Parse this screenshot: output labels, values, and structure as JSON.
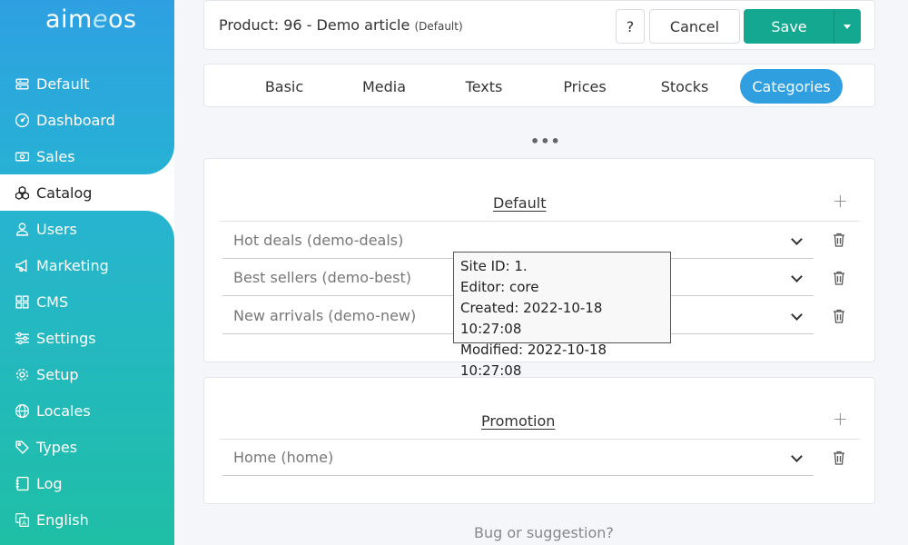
{
  "logo": {
    "text_before": "aim",
    "text_e": "e",
    "text_after": "os"
  },
  "sidebar": {
    "items": [
      {
        "label": "Default",
        "icon": "tray-icon"
      },
      {
        "label": "Dashboard",
        "icon": "dashboard-icon"
      },
      {
        "label": "Sales",
        "icon": "cash-icon"
      },
      {
        "label": "Catalog",
        "icon": "boxes-icon"
      },
      {
        "label": "Users",
        "icon": "user-icon"
      },
      {
        "label": "Marketing",
        "icon": "megaphone-icon"
      },
      {
        "label": "CMS",
        "icon": "grid-icon"
      },
      {
        "label": "Settings",
        "icon": "sliders-icon"
      },
      {
        "label": "Setup",
        "icon": "gear-icon"
      },
      {
        "label": "Locales",
        "icon": "globe-icon"
      },
      {
        "label": "Types",
        "icon": "tags-icon"
      },
      {
        "label": "Log",
        "icon": "journal-icon"
      },
      {
        "label": "English",
        "icon": "translate-icon"
      }
    ],
    "active": "Catalog"
  },
  "header": {
    "title": "Product: 96 - Demo article",
    "title_suffix": "(Default)",
    "help_label": "?",
    "cancel_label": "Cancel",
    "save_label": "Save"
  },
  "tabs": [
    {
      "label": "Basic"
    },
    {
      "label": "Media"
    },
    {
      "label": "Texts"
    },
    {
      "label": "Prices"
    },
    {
      "label": "Stocks"
    },
    {
      "label": "Categories",
      "active": true
    }
  ],
  "more_label": "•••",
  "sections": [
    {
      "title": "Default",
      "plus": "+",
      "rows": [
        {
          "label": "Hot deals (demo-deals)"
        },
        {
          "label": "Best sellers (demo-best)"
        },
        {
          "label": "New arrivals (demo-new)"
        }
      ]
    },
    {
      "title": "Promotion",
      "plus": "+",
      "rows": [
        {
          "label": "Home (home)"
        }
      ]
    }
  ],
  "tooltip": {
    "site": "Site ID: 1.",
    "editor": "Editor: core",
    "created": "Created: 2022-10-18 10:27:08",
    "modified": "Modified: 2022-10-18 10:27:08"
  },
  "footer": {
    "link": "Bug or suggestion?"
  },
  "colors": {
    "accent": "#2f9fe0",
    "save": "#13a88f"
  }
}
